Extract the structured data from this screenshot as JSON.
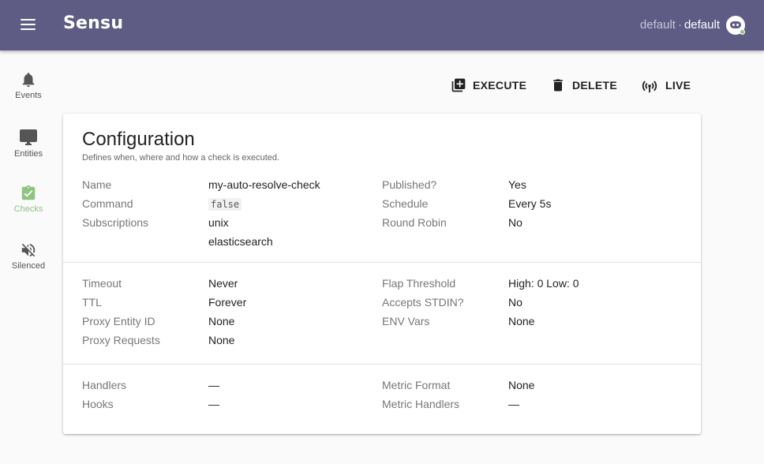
{
  "appbar": {
    "logo": "Sensu",
    "org": "default",
    "separator": "·",
    "env": "default"
  },
  "icons": {
    "menu": "menu-icon",
    "avatar": "user-avatar-icon",
    "events": "bell-icon",
    "entities": "monitor-icon",
    "checks": "clipboard-check-icon",
    "silenced": "volume-off-icon",
    "execute": "add-box-icon",
    "delete": "trash-icon",
    "live": "broadcast-icon"
  },
  "colors": {
    "appbar": "#5e5c85",
    "active_nav": "#8fc380"
  },
  "nav": {
    "items": [
      {
        "label": "Events"
      },
      {
        "label": "Entities"
      },
      {
        "label": "Checks",
        "active": true
      },
      {
        "label": "Silenced"
      }
    ]
  },
  "toolbar": {
    "execute": "EXECUTE",
    "delete": "DELETE",
    "live": "LIVE"
  },
  "card": {
    "title": "Configuration",
    "subtitle": "Defines when, where and how a check is executed.",
    "section1": {
      "name_k": "Name",
      "name_v": "my-auto-resolve-check",
      "command_k": "Command",
      "command_v": "false",
      "subs_k": "Subscriptions",
      "subs_v1": "unix",
      "subs_v2": "elasticsearch",
      "published_k": "Published?",
      "published_v": "Yes",
      "schedule_k": "Schedule",
      "schedule_v": "Every 5s",
      "rr_k": "Round Robin",
      "rr_v": "No"
    },
    "section2": {
      "timeout_k": "Timeout",
      "timeout_v": "Never",
      "ttl_k": "TTL",
      "ttl_v": "Forever",
      "proxy_id_k": "Proxy Entity ID",
      "proxy_id_v": "None",
      "proxy_req_k": "Proxy Requests",
      "proxy_req_v": "None",
      "flap_k": "Flap Threshold",
      "flap_v": "High: 0 Low: 0",
      "stdin_k": "Accepts STDIN?",
      "stdin_v": "No",
      "env_k": "ENV Vars",
      "env_v": "None"
    },
    "section3": {
      "handlers_k": "Handlers",
      "handlers_v": "—",
      "hooks_k": "Hooks",
      "hooks_v": "—",
      "mformat_k": "Metric Format",
      "mformat_v": "None",
      "mhandlers_k": "Metric Handlers",
      "mhandlers_v": "—"
    }
  }
}
